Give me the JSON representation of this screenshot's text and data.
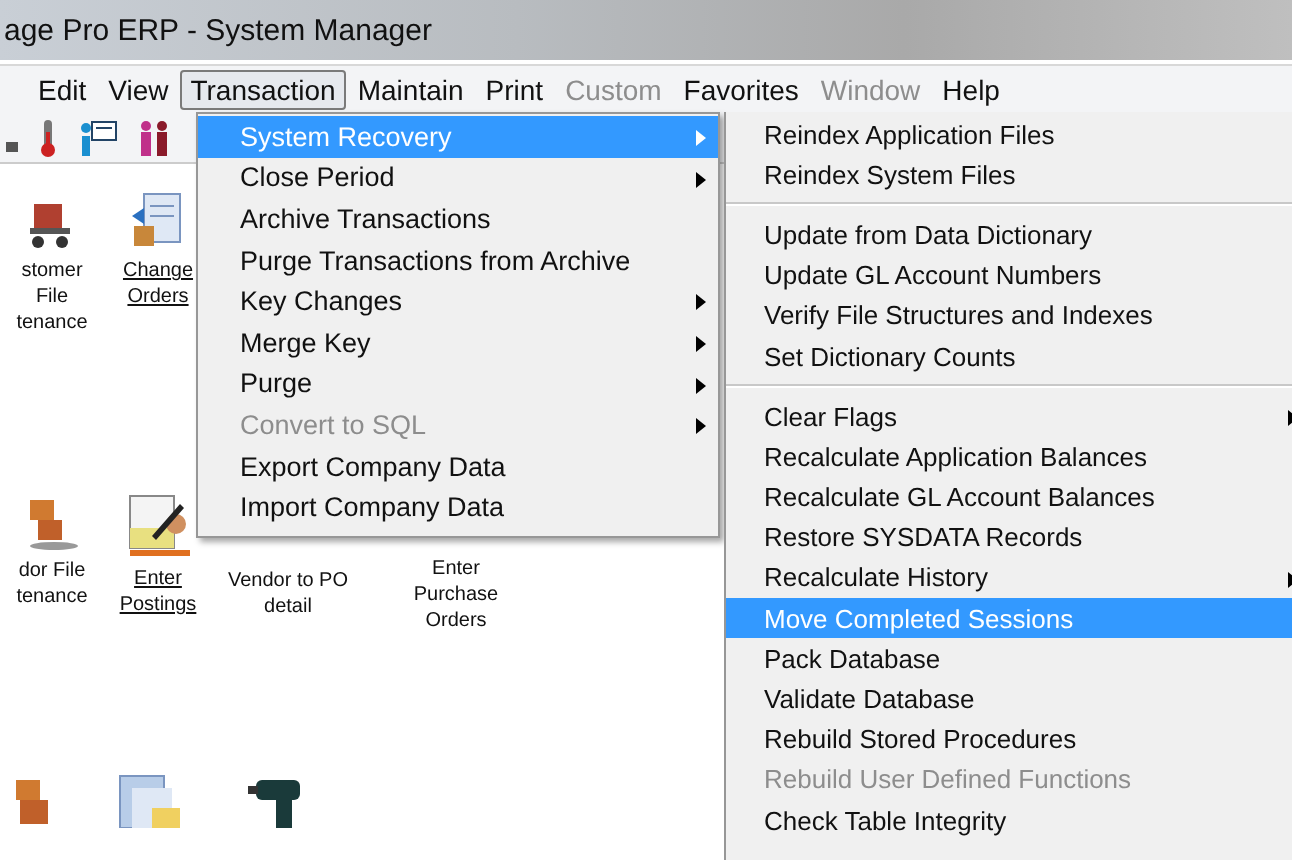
{
  "window": {
    "title": "age Pro ERP - System Manager"
  },
  "menu_bar": [
    {
      "label": "Edit",
      "selected": false,
      "disabled": false
    },
    {
      "label": "View",
      "selected": false,
      "disabled": false
    },
    {
      "label": "Transaction",
      "selected": true,
      "disabled": false
    },
    {
      "label": "Maintain",
      "selected": false,
      "disabled": false
    },
    {
      "label": "Print",
      "selected": false,
      "disabled": false
    },
    {
      "label": "Custom",
      "selected": false,
      "disabled": true
    },
    {
      "label": "Favorites",
      "selected": false,
      "disabled": false
    },
    {
      "label": "Window",
      "selected": false,
      "disabled": true
    },
    {
      "label": "Help",
      "selected": false,
      "disabled": false
    }
  ],
  "shortcuts": [
    {
      "label": "stomer\nFile\ntenance",
      "link": false,
      "kind": "cart"
    },
    {
      "label": "Change\nOrders",
      "link": true,
      "kind": "document"
    },
    {
      "label": "dor File\ntenance",
      "link": false,
      "kind": "boxes"
    },
    {
      "label": "Enter\nPostings",
      "link": true,
      "kind": "pen"
    },
    {
      "label": "Vendor to PO\ndetail",
      "link": false,
      "kind": "plain"
    },
    {
      "label": "Enter\nPurchase\nOrders",
      "link": false,
      "kind": "plain"
    }
  ],
  "transaction_menu": [
    {
      "label": "System Recovery",
      "submenu": true,
      "disabled": false,
      "selected": true
    },
    {
      "label": "Close Period",
      "submenu": true,
      "disabled": false,
      "selected": false
    },
    {
      "label": "Archive Transactions",
      "submenu": false,
      "disabled": false,
      "selected": false
    },
    {
      "label": "Purge Transactions from Archive",
      "submenu": false,
      "disabled": false,
      "selected": false
    },
    {
      "label": "Key Changes",
      "submenu": true,
      "disabled": false,
      "selected": false
    },
    {
      "label": "Merge Key",
      "submenu": true,
      "disabled": false,
      "selected": false
    },
    {
      "label": "Purge",
      "submenu": true,
      "disabled": false,
      "selected": false
    },
    {
      "label": "Convert to SQL",
      "submenu": true,
      "disabled": true,
      "selected": false
    },
    {
      "label": "Export Company Data",
      "submenu": false,
      "disabled": false,
      "selected": false
    },
    {
      "label": "Import Company Data",
      "submenu": false,
      "disabled": false,
      "selected": false
    }
  ],
  "system_recovery_menu": [
    {
      "items": [
        {
          "label": "Reindex Application Files",
          "submenu": false,
          "disabled": false,
          "selected": false
        },
        {
          "label": "Reindex System Files",
          "submenu": false,
          "disabled": false,
          "selected": false
        }
      ]
    },
    {
      "items": [
        {
          "label": "Update from Data Dictionary",
          "submenu": false,
          "disabled": false,
          "selected": false
        },
        {
          "label": "Update GL Account Numbers",
          "submenu": false,
          "disabled": false,
          "selected": false
        },
        {
          "label": "Verify File Structures and Indexes",
          "submenu": false,
          "disabled": false,
          "selected": false
        },
        {
          "label": "Set Dictionary Counts",
          "submenu": false,
          "disabled": false,
          "selected": false
        }
      ]
    },
    {
      "items": [
        {
          "label": "Clear Flags",
          "submenu": true,
          "disabled": false,
          "selected": false
        },
        {
          "label": "Recalculate Application Balances",
          "submenu": false,
          "disabled": false,
          "selected": false
        },
        {
          "label": "Recalculate GL Account Balances",
          "submenu": false,
          "disabled": false,
          "selected": false
        },
        {
          "label": "Restore SYSDATA Records",
          "submenu": false,
          "disabled": false,
          "selected": false
        },
        {
          "label": "Recalculate History",
          "submenu": true,
          "disabled": false,
          "selected": false
        },
        {
          "label": "Move Completed Sessions",
          "submenu": false,
          "disabled": false,
          "selected": true
        },
        {
          "label": "Pack Database",
          "submenu": false,
          "disabled": false,
          "selected": false
        },
        {
          "label": "Validate Database",
          "submenu": false,
          "disabled": false,
          "selected": false
        },
        {
          "label": "Rebuild Stored Procedures",
          "submenu": false,
          "disabled": false,
          "selected": false
        },
        {
          "label": "Rebuild User Defined Functions",
          "submenu": false,
          "disabled": true,
          "selected": false
        },
        {
          "label": "Check Table Integrity",
          "submenu": false,
          "disabled": false,
          "selected": false
        }
      ]
    }
  ]
}
